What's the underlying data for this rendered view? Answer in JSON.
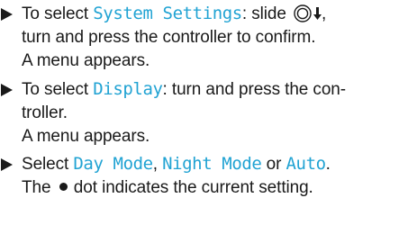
{
  "steps": [
    {
      "parts": {
        "a": "To select ",
        "menu": "System Settings",
        "b": ": slide ",
        "c": ",",
        "line2": "turn and press the controller to confirm.",
        "line3": "A menu appears."
      },
      "icons": [
        "controller-icon",
        "arrow-down-icon"
      ]
    },
    {
      "parts": {
        "a": "To select ",
        "menu": "Display",
        "b": ": turn and press the con-",
        "line2": "troller.",
        "line3": "A menu appears."
      }
    },
    {
      "parts": {
        "a": "Select ",
        "opt1": "Day Mode",
        "sep1": ", ",
        "opt2": "Night Mode",
        "sep2": " or ",
        "opt3": "Auto",
        "end": ".",
        "line2a": "The ",
        "line2b": " dot indicates the current setting."
      },
      "icons": [
        "filled-dot-icon"
      ]
    }
  ],
  "colors": {
    "text": "#1a1a1a",
    "highlight": "#21a3d3"
  }
}
